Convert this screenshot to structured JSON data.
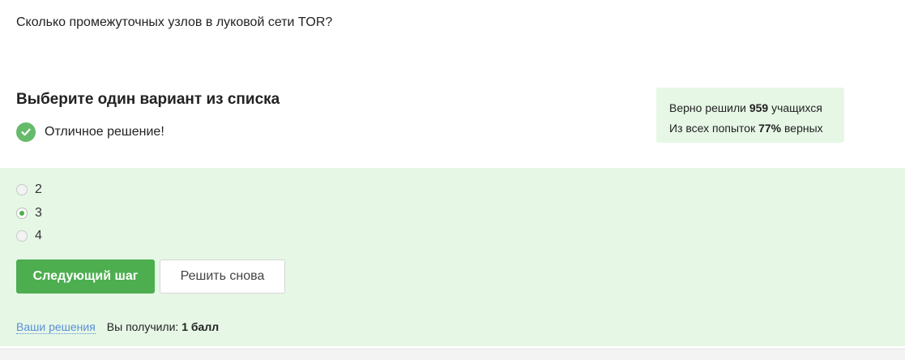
{
  "question": {
    "text": "Сколько промежуточных узлов в луковой сети TOR?"
  },
  "task": {
    "title": "Выберите один вариант из списка",
    "feedback": "Отличное решение!"
  },
  "stats": {
    "line1_prefix": "Верно решили ",
    "solved_count": "959",
    "line1_suffix": " учащихся",
    "line2_prefix": "Из всех попыток ",
    "percent": "77%",
    "line2_suffix": " верных"
  },
  "options": [
    {
      "label": "2",
      "selected": false
    },
    {
      "label": "3",
      "selected": true
    },
    {
      "label": "4",
      "selected": false
    }
  ],
  "buttons": {
    "next": "Следующий шаг",
    "retry": "Решить снова"
  },
  "footer": {
    "link": "Ваши решения",
    "score_prefix": "Вы получили: ",
    "score": "1 балл"
  },
  "colors": {
    "accent_green": "#4cae4f",
    "panel_green": "#e6f7e6",
    "link_blue": "#5a8fd6"
  },
  "icons": {
    "feedback": "check-circle-icon"
  }
}
